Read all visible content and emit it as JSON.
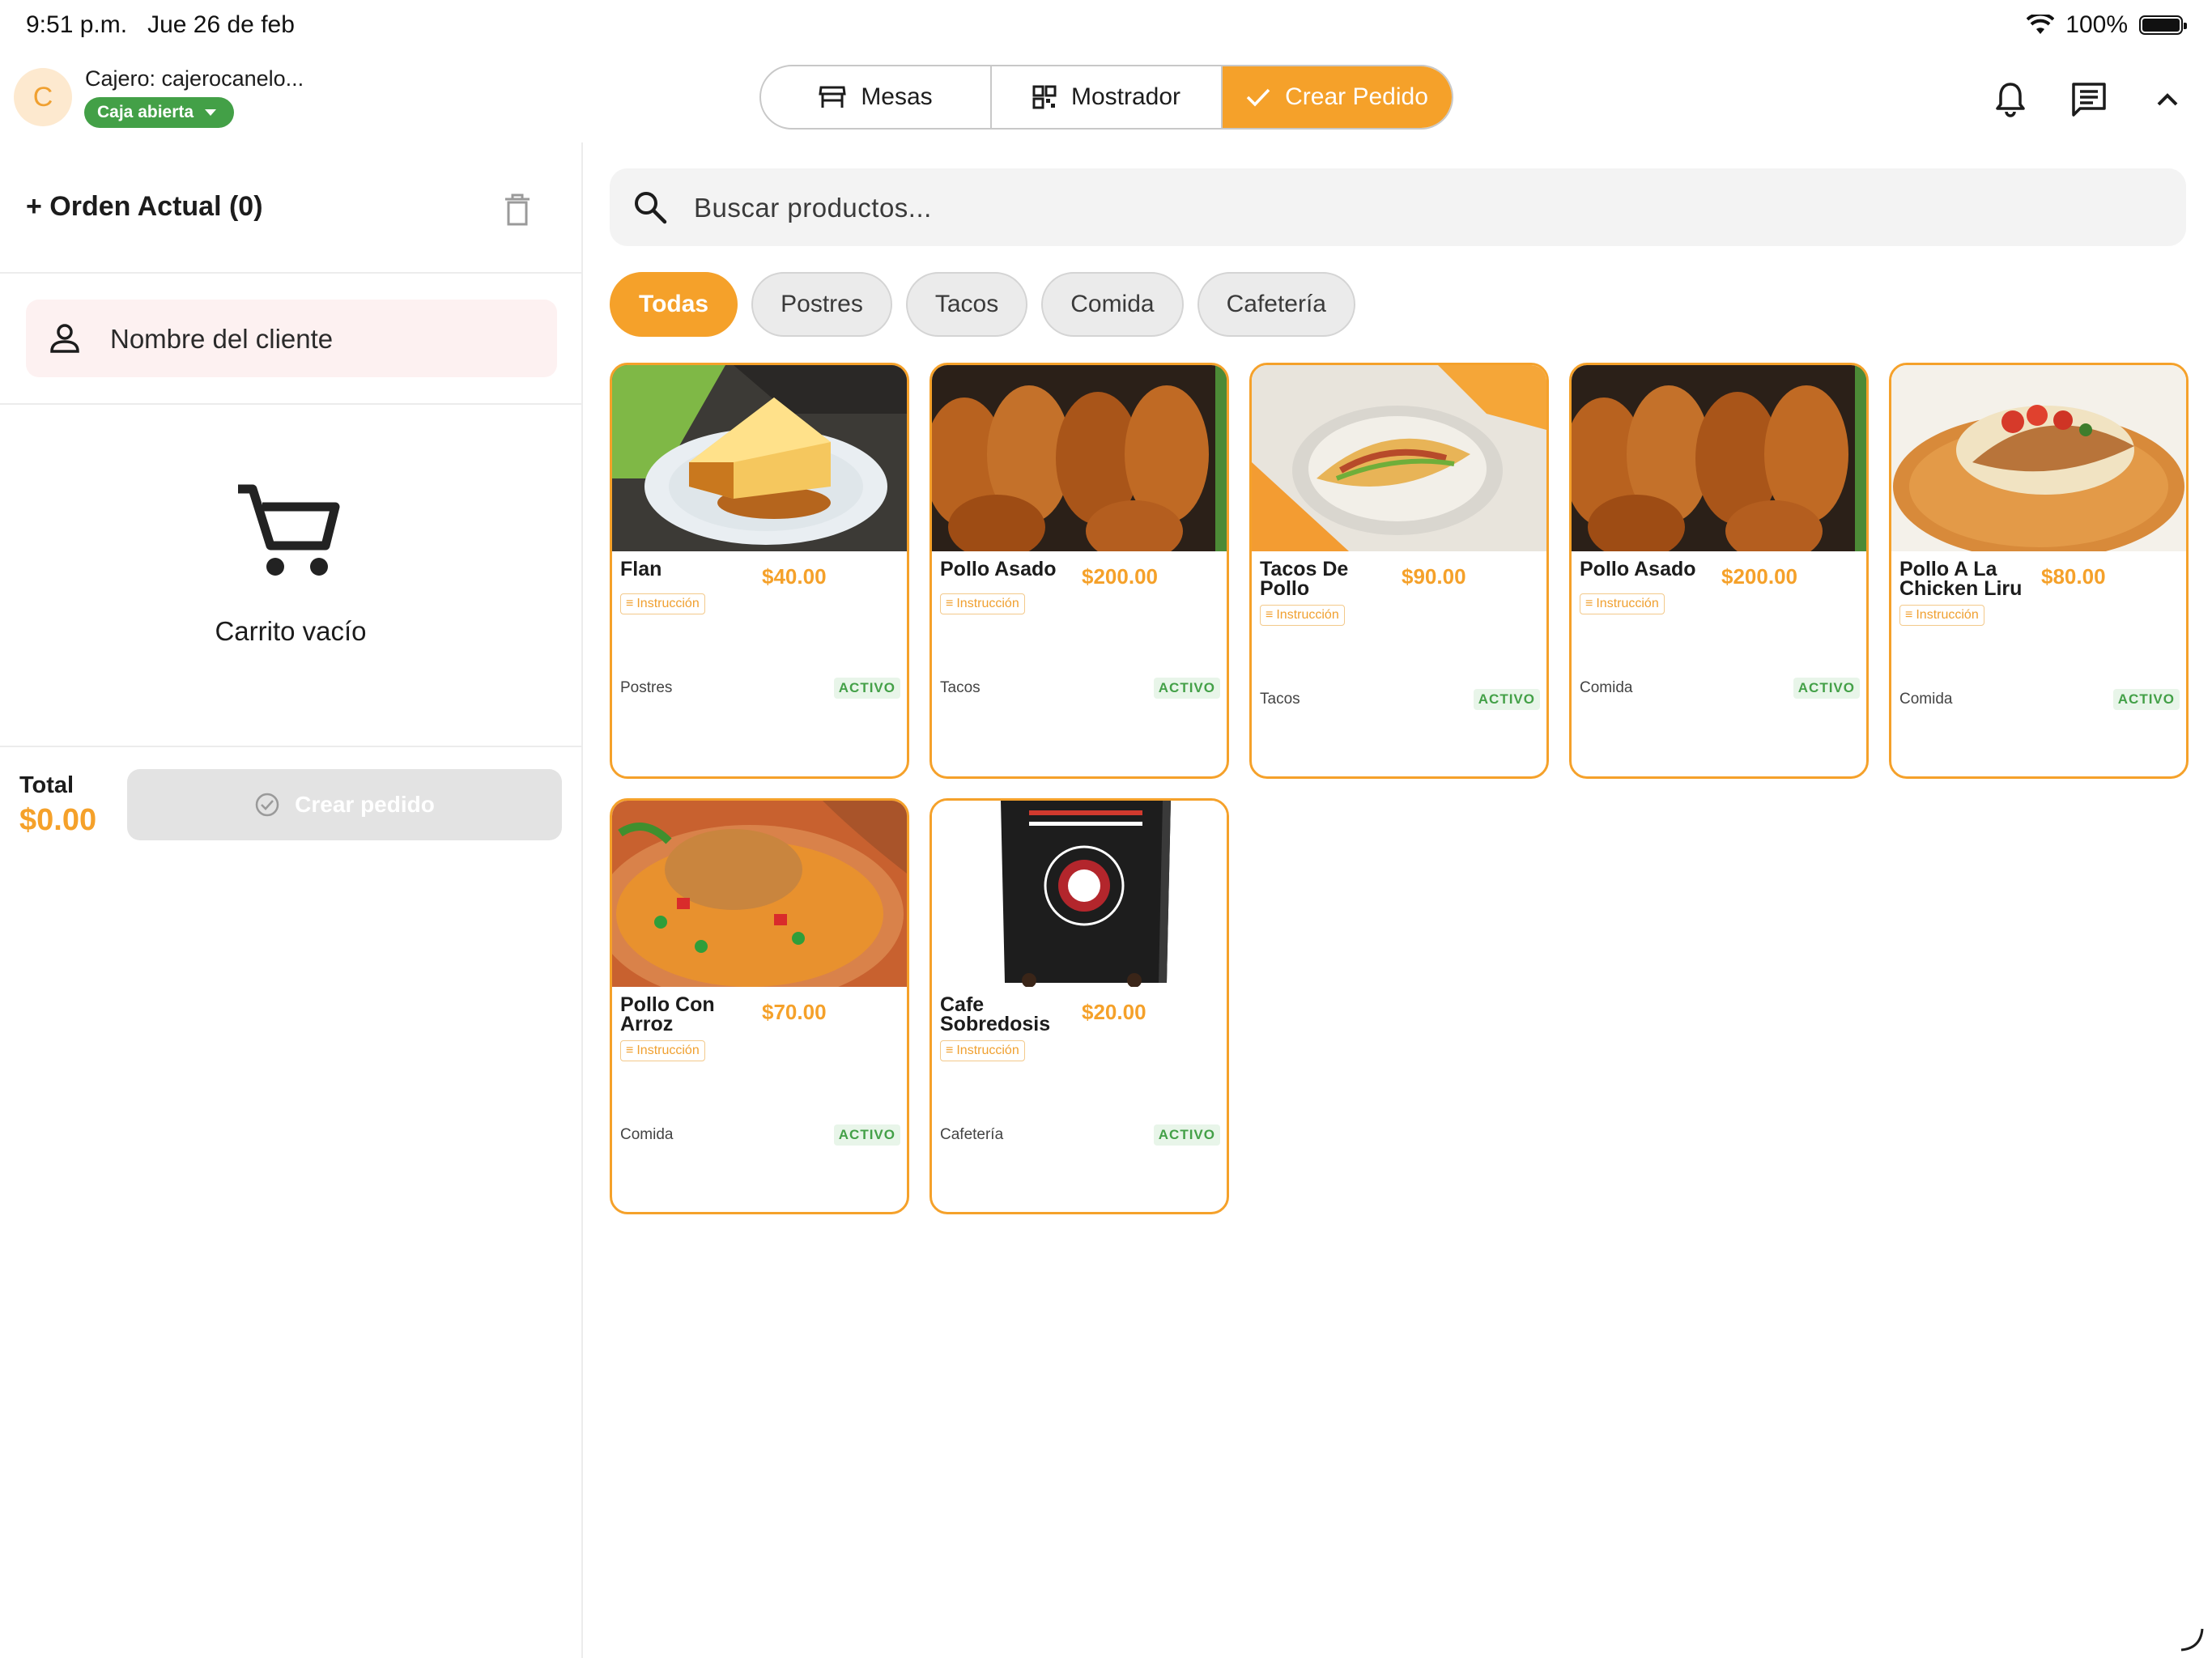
{
  "status_bar": {
    "time": "9:51 p.m.",
    "date": "Jue 26 de feb",
    "battery": "100%",
    "battery_level": 1.0
  },
  "header": {
    "avatar_initial": "C",
    "cashier": "Cajero: cajerocanelo...",
    "caja_status": "Caja abierta",
    "segments": [
      {
        "label": "Mesas",
        "icon": "store-icon"
      },
      {
        "label": "Mostrador",
        "icon": "grid-icon"
      },
      {
        "label": "Crear Pedido",
        "icon": "check-icon",
        "selected": true
      }
    ],
    "icons": [
      "bell-icon",
      "message-icon",
      "chevron-up-icon"
    ]
  },
  "order": {
    "title": "+ Orden Actual (0)",
    "client_placeholder": "Nombre del cliente",
    "empty_cart": "Carrito vacío",
    "total_label": "Total",
    "total_value": "$0.00",
    "create_button": "Crear pedido"
  },
  "search": {
    "placeholder": "Buscar productos..."
  },
  "categories": [
    {
      "label": "Todas",
      "active": true
    },
    {
      "label": "Postres",
      "active": false
    },
    {
      "label": "Tacos",
      "active": false
    },
    {
      "label": "Comida",
      "active": false
    },
    {
      "label": "Cafetería",
      "active": false
    }
  ],
  "products": [
    {
      "name": "Flan",
      "price": "$40.00",
      "instruction": "Instrucción",
      "category": "Postres",
      "status": "ACTIVO",
      "image": "flan"
    },
    {
      "name": "Pollo Asado",
      "price": "$200.00",
      "instruction": "Instrucción",
      "category": "Tacos",
      "status": "ACTIVO",
      "image": "roast-chicken"
    },
    {
      "name": "Tacos De Pollo",
      "price": "$90.00",
      "instruction": "Instrucción",
      "category": "Tacos",
      "status": "ACTIVO",
      "image": "tacos"
    },
    {
      "name": "Pollo Asado",
      "price": "$200.00",
      "instruction": "Instrucción",
      "category": "Comida",
      "status": "ACTIVO",
      "image": "roast-chicken"
    },
    {
      "name": "Pollo A La Chicken Liru",
      "price": "$80.00",
      "instruction": "Instrucción",
      "category": "Comida",
      "status": "ACTIVO",
      "image": "chicken-rice-plate"
    },
    {
      "name": "Pollo Con Arroz",
      "price": "$70.00",
      "instruction": "Instrucción",
      "category": "Comida",
      "status": "ACTIVO",
      "image": "chicken-rice"
    },
    {
      "name": "Cafe Sobredosis",
      "price": "$20.00",
      "instruction": "Instrucción",
      "category": "Cafetería",
      "status": "ACTIVO",
      "image": "coffee-bag"
    }
  ],
  "colors": {
    "accent": "#f5a12a",
    "success": "#43a047",
    "card_border": "#f5a12a"
  }
}
